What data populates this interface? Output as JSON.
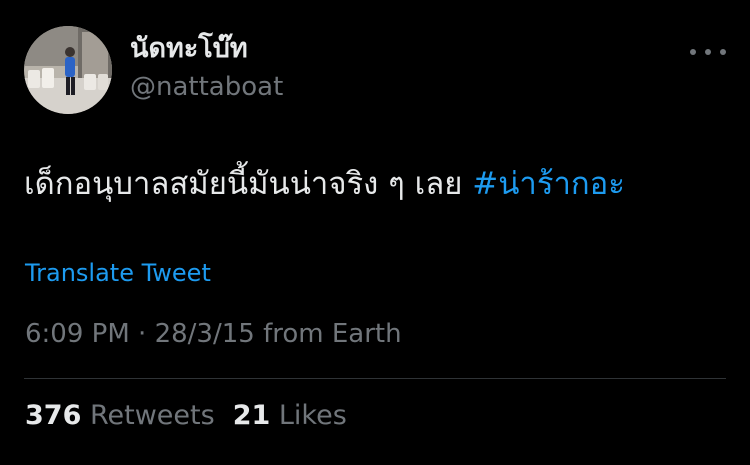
{
  "author": {
    "display_name": "นัดทะโบ๊ท",
    "handle": "@nattaboat"
  },
  "tweet": {
    "text": "เด็กอนุบาลสมัยนี้มันน่าจริง ๆ เลย ",
    "hashtag": "#น่าร้ากอะ",
    "translate_label": "Translate Tweet",
    "time": "6:09 PM",
    "separator": "·",
    "date": "28/3/15",
    "source_prefix": "from",
    "source": "Earth"
  },
  "stats": {
    "retweets_count": "376",
    "retweets_label": "Retweets",
    "likes_count": "21",
    "likes_label": "Likes"
  },
  "icons": {
    "more": "more-dots-icon"
  },
  "colors": {
    "background": "#000000",
    "primary_text": "#e7e9ea",
    "secondary_text": "#71767b",
    "link": "#1d9bf0",
    "divider": "#2f3336"
  }
}
